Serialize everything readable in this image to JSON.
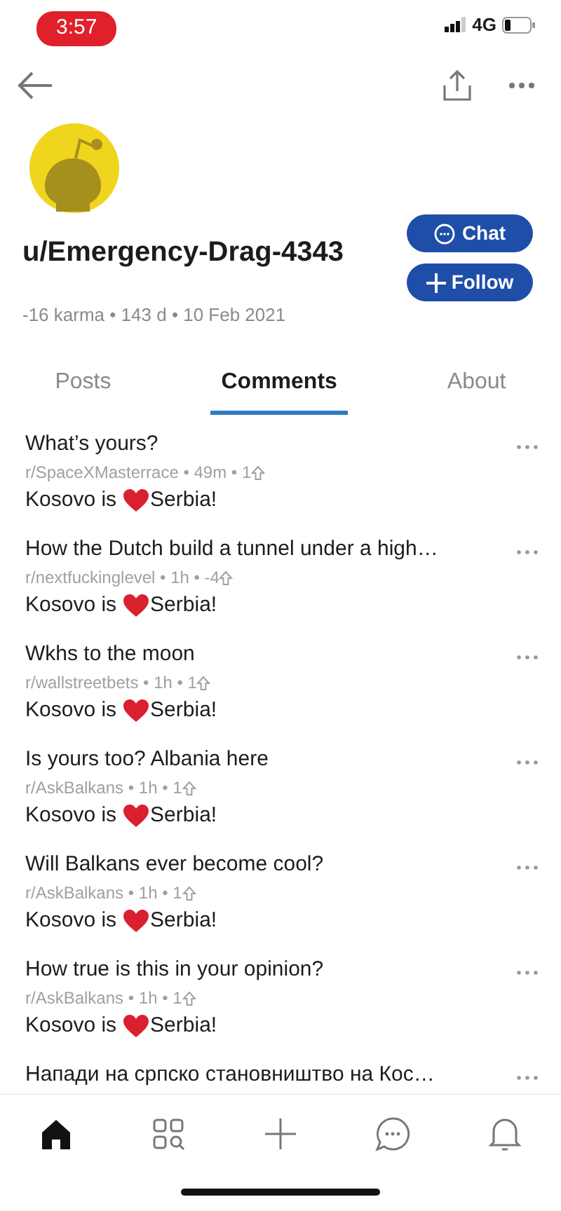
{
  "status_bar": {
    "time": "3:57",
    "network": "4G"
  },
  "profile": {
    "username": "u/Emergency-Drag-4343",
    "stats": "-16 karma • 143 d • 10 Feb 2021",
    "chat_label": "Chat",
    "follow_label": "Follow"
  },
  "tabs": [
    {
      "label": "Posts",
      "selected": false
    },
    {
      "label": "Comments",
      "selected": true
    },
    {
      "label": "About",
      "selected": false
    }
  ],
  "comments": [
    {
      "title": "What’s yours?",
      "meta": "r/SpaceXMasterrace • 49m • 1",
      "body_start": "Kosovo is",
      "body_end": "Serbia!"
    },
    {
      "title": "How the Dutch build a tunnel under a high…",
      "meta": "r/nextfuckinglevel • 1h • -4",
      "body_start": "Kosovo is",
      "body_end": "Serbia!"
    },
    {
      "title": "Wkhs to the moon",
      "meta": "r/wallstreetbets • 1h • 1",
      "body_start": "Kosovo is",
      "body_end": "Serbia!"
    },
    {
      "title": "Is yours too? Albania here",
      "meta": "r/AskBalkans • 1h • 1",
      "body_start": "Kosovo is",
      "body_end": "Serbia!"
    },
    {
      "title": "Will Balkans ever become cool?",
      "meta": "r/AskBalkans • 1h • 1",
      "body_start": "Kosovo is",
      "body_end": "Serbia!"
    },
    {
      "title": "How true is this in your opinion?",
      "meta": "r/AskBalkans • 1h • 1",
      "body_start": "Kosovo is",
      "body_end": "Serbia!"
    },
    {
      "title": "Напади на српско становништво на Кос…"
    }
  ],
  "bottom_nav": [
    {
      "kind": "home",
      "selected": true
    },
    {
      "kind": "discover",
      "selected": false
    },
    {
      "kind": "create",
      "selected": false
    },
    {
      "kind": "chat",
      "selected": false
    },
    {
      "kind": "inbox",
      "selected": false
    }
  ]
}
